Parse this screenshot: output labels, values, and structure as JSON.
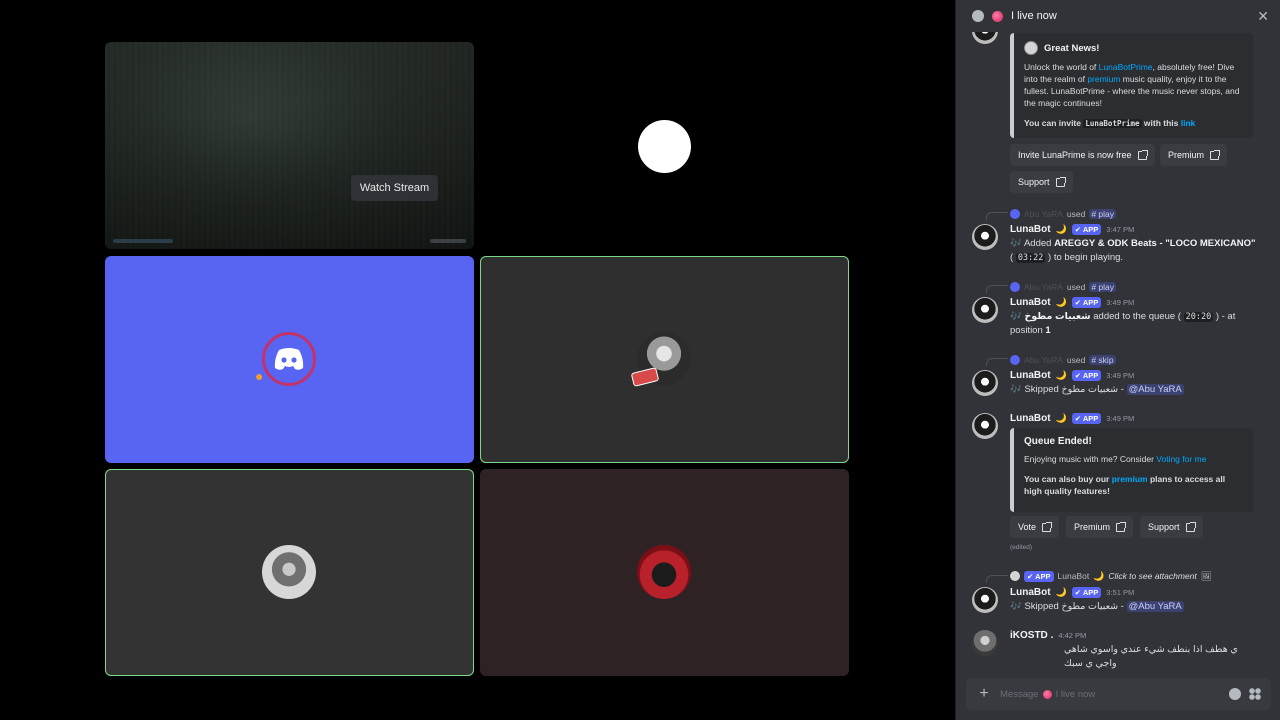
{
  "stage": {
    "watch_stream": "Watch Stream"
  },
  "panel": {
    "title": "I live now",
    "close_glyph": "✕"
  },
  "messages": {
    "promo": {
      "title": "Great News!",
      "p1_a": "Unlock the world of ",
      "p1_link": "LunaBotPrime",
      "p1_b": ", absolutely free! Dive into the realm of ",
      "p1_premium": "premium",
      "p1_c": " music quality, enjoy it to the fullest. LunaBotPrime - where the music never stops, and the magic continues!",
      "p2_a": "You can invite ",
      "p2_code": "LunaBotPrime",
      "p2_b": " with this ",
      "p2_link": "link",
      "buttons": [
        "Invite LunaPrime is now free",
        "Premium",
        "Support"
      ]
    },
    "m1": {
      "reply_name": "Abu YaRA",
      "reply_used": "used",
      "reply_cmd": "# play",
      "name": "LunaBot",
      "moon": "🌙",
      "app": "✔ APP",
      "time": "3:47 PM",
      "text_a": "🎶 Added ",
      "text_b": "AREGGY & ODK Beats - \"LOCO MEXICANO\"",
      "text_c": " ( ",
      "pill": "03:22",
      "text_d": " ) to begin playing."
    },
    "m2": {
      "reply_name": "Abu YaRA",
      "reply_used": "used",
      "reply_cmd": "# play",
      "name": "LunaBot",
      "moon": "🌙",
      "app": "✔ APP",
      "time": "3:49 PM",
      "text_a": "🎶 ",
      "text_b": "شعبيات مطوخ",
      "text_c": " added to the queue ( ",
      "pill": "20:20",
      "text_d": " ) - at position ",
      "text_e": "1"
    },
    "m3": {
      "reply_name": "Abu YaRA",
      "reply_used": "used",
      "reply_cmd": "# skip",
      "name": "LunaBot",
      "moon": "🌙",
      "app": "✔ APP",
      "time": "3:49 PM",
      "text_a": "🎶 Skipped ",
      "text_b": "شعبيات مطوخ",
      "text_c": " - ",
      "mention": "@Abu YaRA"
    },
    "m4": {
      "name": "LunaBot",
      "moon": "🌙",
      "app": "✔ APP",
      "time": "3:49 PM",
      "embed_title": "Queue Ended!",
      "e1_a": "Enjoying music with me? Consider ",
      "e1_link": "Voting for me",
      "e2_a": "You can also buy our ",
      "e2_link": "premium",
      "e2_b": " plans to access all high quality features!",
      "buttons": [
        "Vote",
        "Premium",
        "Support"
      ],
      "edited": "(edited)"
    },
    "m5": {
      "reply_app": "✔ APP",
      "reply_name": "LunaBot",
      "reply_moon": "🌙",
      "reply_text": "Click to see attachment",
      "reply_img": "🖼",
      "name": "LunaBot",
      "moon": "🌙",
      "app": "✔ APP",
      "time": "3:51 PM",
      "text_a": "🎶 Skipped ",
      "text_b": "شعبيات مطوخ",
      "text_c": " - ",
      "mention": "@Abu YaRA"
    },
    "m6": {
      "name": "iKOSTD .",
      "time": "4:42 PM",
      "text": "ي هطف اذا بنطف شيء عندي واسوي شاهي واجي ي سبك"
    }
  },
  "composer": {
    "plus": "+",
    "placeholder_a": "Message",
    "placeholder_b": "I live now"
  },
  "colors": {
    "accent": "#5865f2",
    "link": "#00a8fc",
    "speaking": "#7cd989",
    "panel_bg": "#313338"
  }
}
